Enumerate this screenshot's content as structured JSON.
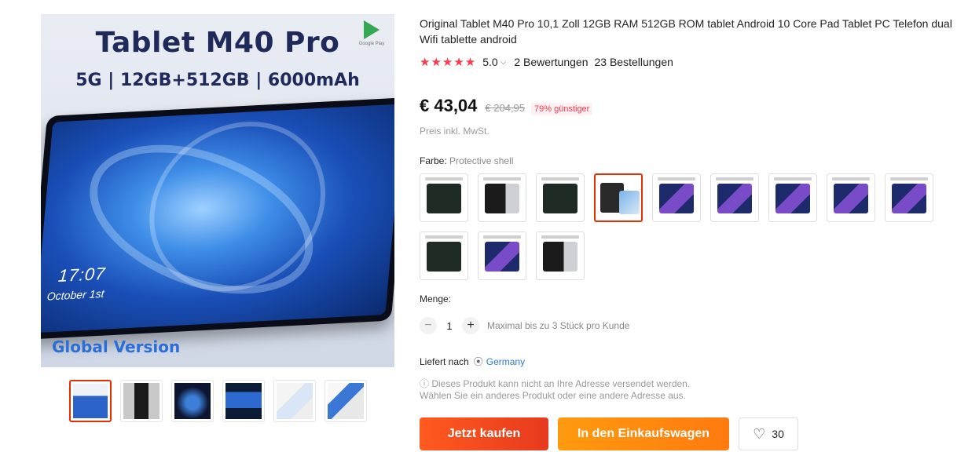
{
  "gallery": {
    "main_title": "Tablet M40 Pro",
    "main_specs": "5G | 12GB+512GB | 6000mAh",
    "store_badge": "Google Play",
    "screen_time": "17:07",
    "screen_date": "October 1st",
    "footer_text": "Global Version",
    "thumbnails": [
      "t1",
      "t2",
      "t3",
      "t4",
      "t5",
      "t6"
    ]
  },
  "product": {
    "title": "Original Tablet M40 Pro 10,1 Zoll 12GB RAM 512GB ROM tablet Android 10 Core Pad Tablet PC Telefon dual Wifi tablette android",
    "stars": "★★★★★",
    "rating": "5.0",
    "rating_chevron": "⌵",
    "reviews": "2 Bewertungen",
    "orders": "23 Bestellungen"
  },
  "pricing": {
    "price": "€ 43,04",
    "old_price": "€ 204,95",
    "discount": "79% günstiger",
    "tax_note": "Preis inkl. MwSt."
  },
  "variant": {
    "label": "Farbe:",
    "selected_value": "Protective shell",
    "options_count": 13,
    "selected_index": 3
  },
  "quantity": {
    "label": "Menge:",
    "minus": "−",
    "value": "1",
    "plus": "+",
    "note": "Maximal bis zu 3 Stück pro Kunde"
  },
  "shipping": {
    "label": "Liefert nach",
    "pin_icon": "location-pin-icon",
    "country": "Germany",
    "notice_line1": "ⓘ Dieses Produkt kann nicht an Ihre Adresse versendet werden.",
    "notice_line2": "Wählen Sie ein anderes Produkt oder eine andere Adresse aus."
  },
  "actions": {
    "buy_now": "Jetzt kaufen",
    "add_to_cart": "In den Einkaufswagen",
    "wishlist_count": "30"
  },
  "colors": {
    "accent_red": "#fd384f",
    "buy_orange_red": "#ff5a1f",
    "cart_orange": "#ff9a0e",
    "link_blue": "#2e7bd6"
  }
}
